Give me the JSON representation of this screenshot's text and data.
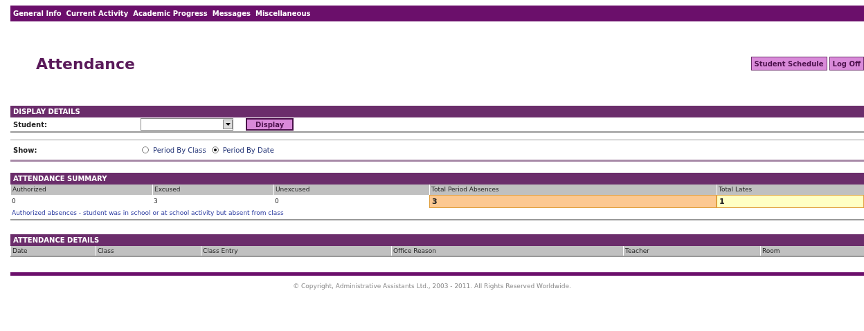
{
  "nav": {
    "items": [
      "General Info",
      "Current Activity",
      "Academic Progress",
      "Messages",
      "Miscellaneous"
    ]
  },
  "title": "Attendance",
  "header_buttons": [
    "Student Schedule",
    "Log Off"
  ],
  "display_details": {
    "heading": "DISPLAY DETAILS",
    "student_label": "Student:",
    "display_button": "Display",
    "show_label": "Show:",
    "options": [
      {
        "label": "Period By Class",
        "selected": false
      },
      {
        "label": "Period By Date",
        "selected": true
      }
    ]
  },
  "summary": {
    "heading": "ATTENDANCE SUMMARY",
    "columns": [
      {
        "label": "Authorized",
        "value": "0",
        "kind": "plain"
      },
      {
        "label": "Excused",
        "value": "3",
        "kind": "plain"
      },
      {
        "label": "Unexcused",
        "value": "0",
        "kind": "plain"
      },
      {
        "label": "Total Period Absences",
        "value": "3",
        "kind": "highlight",
        "color": "#fcc891"
      },
      {
        "label": "Total Lates",
        "value": "1",
        "kind": "highlight",
        "color": "#ffffc4"
      }
    ],
    "note": "Authorized absences - student was in school or at school activity but absent from class"
  },
  "details": {
    "heading": "ATTENDANCE DETAILS",
    "columns": [
      "Date",
      "Class",
      "Class Entry",
      "Office Reason",
      "Teacher",
      "Room"
    ]
  },
  "footer": "© Copyright, Administrative Assistants Ltd., 2003 - 2011. All Rights Reserved Worldwide."
}
